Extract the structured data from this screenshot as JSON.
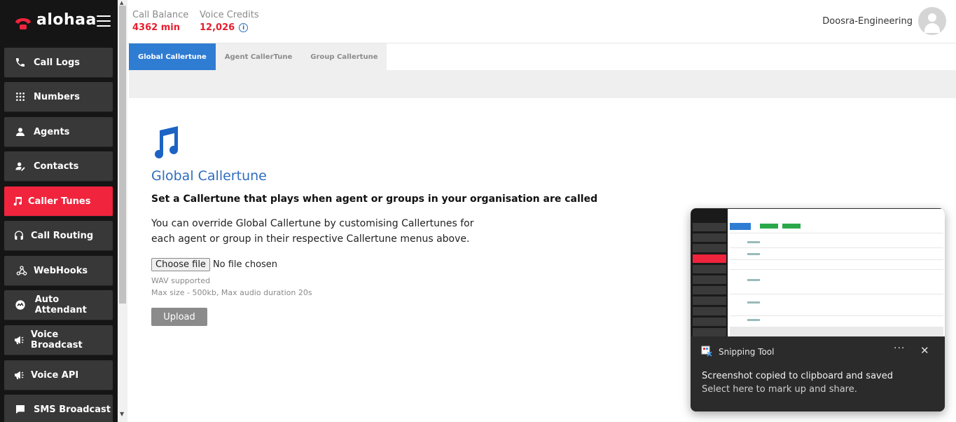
{
  "brand": {
    "name": "alohaa"
  },
  "sidebar": {
    "items": [
      {
        "label": "Call Logs",
        "icon": "phone-icon"
      },
      {
        "label": "Numbers",
        "icon": "dialpad-icon"
      },
      {
        "label": "Agents",
        "icon": "person-icon"
      },
      {
        "label": "Contacts",
        "icon": "contacts-icon"
      },
      {
        "label": "Caller Tunes",
        "icon": "music-note-icon",
        "active": true
      },
      {
        "label": "Call Routing",
        "icon": "headset-icon"
      },
      {
        "label": "WebHooks",
        "icon": "webhook-icon"
      },
      {
        "label": "Auto Attendant",
        "icon": "auto-attendant-icon"
      },
      {
        "label": "Voice Broadcast",
        "icon": "megaphone-icon"
      },
      {
        "label": "Voice API",
        "icon": "megaphone-icon"
      },
      {
        "label": "SMS Broadcast",
        "icon": "sms-icon"
      }
    ]
  },
  "header": {
    "call_balance_label": "Call Balance",
    "call_balance_value": "4362 min",
    "voice_credits_label": "Voice Credits",
    "voice_credits_value": "12,026",
    "username": "Doosra-Engineering"
  },
  "tabs": [
    {
      "label": "Global Callertune",
      "active": true
    },
    {
      "label": "Agent CallerTune"
    },
    {
      "label": "Group Callertune"
    }
  ],
  "main": {
    "title": "Global Callertune",
    "subtitle": "Set a Callertune that plays when agent or groups in your organisation are called",
    "description_line1": "You can override Global Callertune by customising Callertunes for",
    "description_line2": "each agent or group in their respective Callertune menus above.",
    "choose_file_label": "Choose file",
    "no_file_text": "No file chosen",
    "format_hint": "WAV supported",
    "size_hint": "Max size - 500kb, Max audio duration 20s",
    "upload_label": "Upload"
  },
  "toast": {
    "app_name": "Snipping Tool",
    "message": "Screenshot copied to clipboard and saved",
    "sub_message": "Select here to mark up and share.",
    "more_label": "···",
    "close_label": "✕"
  },
  "colors": {
    "accent_red": "#f0243d",
    "accent_blue": "#2f7cd3",
    "sidebar_bg": "#151515",
    "nav_item_bg": "#383838"
  }
}
